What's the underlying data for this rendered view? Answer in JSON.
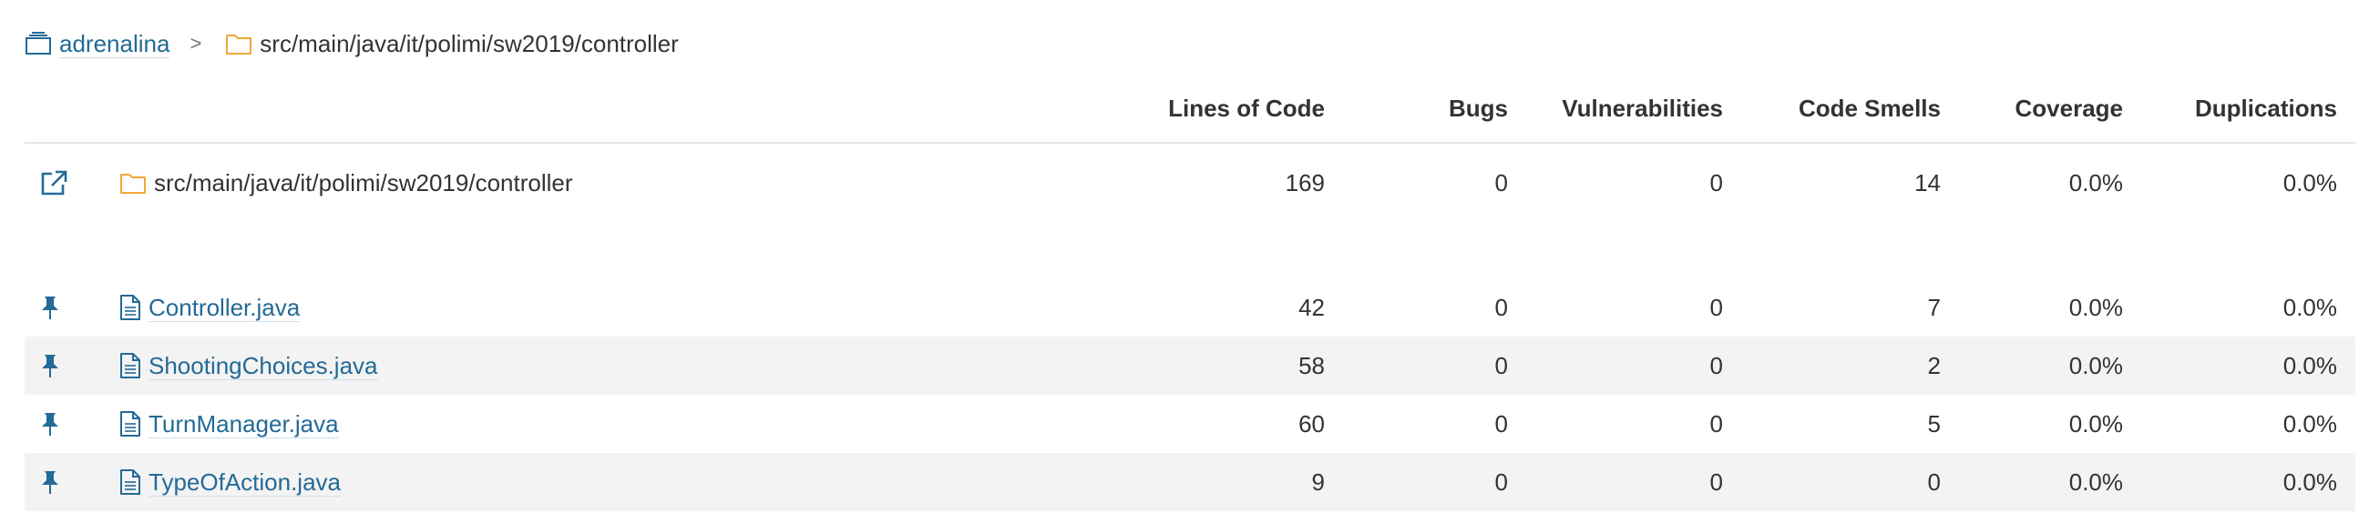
{
  "breadcrumb": {
    "project": "adrenalina",
    "separator": ">",
    "directory": "src/main/java/it/polimi/sw2019/controller"
  },
  "columns": {
    "loc": "Lines of Code",
    "bugs": "Bugs",
    "vulnerabilities": "Vulnerabilities",
    "code_smells": "Code Smells",
    "coverage": "Coverage",
    "duplications": "Duplications"
  },
  "base_row": {
    "name": "src/main/java/it/polimi/sw2019/controller",
    "loc": "169",
    "bugs": "0",
    "vulnerabilities": "0",
    "code_smells": "14",
    "coverage": "0.0%",
    "duplications": "0.0%"
  },
  "files": [
    {
      "name": "Controller.java",
      "loc": "42",
      "bugs": "0",
      "vulnerabilities": "0",
      "code_smells": "7",
      "coverage": "0.0%",
      "duplications": "0.0%"
    },
    {
      "name": "ShootingChoices.java",
      "loc": "58",
      "bugs": "0",
      "vulnerabilities": "0",
      "code_smells": "2",
      "coverage": "0.0%",
      "duplications": "0.0%"
    },
    {
      "name": "TurnManager.java",
      "loc": "60",
      "bugs": "0",
      "vulnerabilities": "0",
      "code_smells": "5",
      "coverage": "0.0%",
      "duplications": "0.0%"
    },
    {
      "name": "TypeOfAction.java",
      "loc": "9",
      "bugs": "0",
      "vulnerabilities": "0",
      "code_smells": "0",
      "coverage": "0.0%",
      "duplications": "0.0%"
    }
  ],
  "colors": {
    "link": "#236a97",
    "folder": "#f0a837",
    "row_alt": "#f3f3f3",
    "divider": "#e6e6e6"
  },
  "icons": {
    "project": "project-icon",
    "folder": "folder-icon",
    "open": "open-in-new-icon",
    "pin": "pin-icon",
    "file": "file-icon"
  }
}
